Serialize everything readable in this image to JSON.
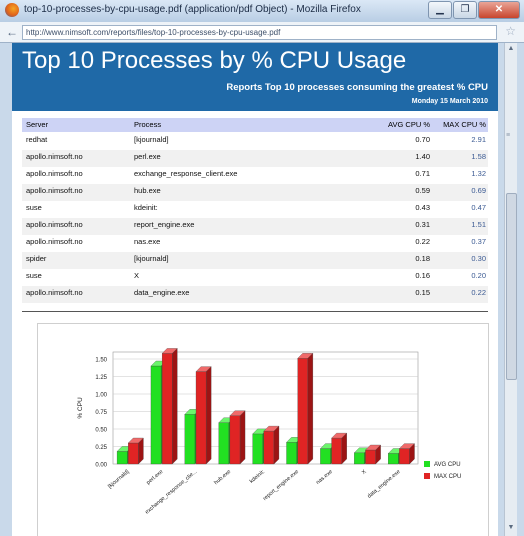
{
  "window": {
    "title": "top-10-processes-by-cpu-usage.pdf (application/pdf Object) - Mozilla Firefox",
    "url": "http://www.nimsoft.com/reports/files/top-10-processes-by-cpu-usage.pdf",
    "buttons": {
      "minimize": "▁",
      "maximize": "❐",
      "close": "✕"
    }
  },
  "report": {
    "title": "Top 10 Processes by % CPU Usage",
    "subtitle": "Reports Top 10 processes consuming the greatest % CPU",
    "date": "Monday 15 March 2010",
    "columns": [
      "Server",
      "Process",
      "AVG CPU %",
      "MAX CPU %"
    ],
    "rows": [
      {
        "server": "redhat",
        "process": "[kjournald]",
        "avg": "0.70",
        "max": "2.91"
      },
      {
        "server": "apollo.nimsoft.no",
        "process": "perl.exe",
        "avg": "1.40",
        "max": "1.58"
      },
      {
        "server": "apollo.nimsoft.no",
        "process": "exchange_response_client.exe",
        "avg": "0.71",
        "max": "1.32"
      },
      {
        "server": "apollo.nimsoft.no",
        "process": "hub.exe",
        "avg": "0.59",
        "max": "0.69"
      },
      {
        "server": "suse",
        "process": "kdeinit:",
        "avg": "0.43",
        "max": "0.47"
      },
      {
        "server": "apollo.nimsoft.no",
        "process": "report_engine.exe",
        "avg": "0.31",
        "max": "1.51"
      },
      {
        "server": "apollo.nimsoft.no",
        "process": "nas.exe",
        "avg": "0.22",
        "max": "0.37"
      },
      {
        "server": "spider",
        "process": "[kjournald]",
        "avg": "0.18",
        "max": "0.30"
      },
      {
        "server": "suse",
        "process": "X",
        "avg": "0.16",
        "max": "0.20"
      },
      {
        "server": "apollo.nimsoft.no",
        "process": "data_engine.exe",
        "avg": "0.15",
        "max": "0.22"
      }
    ]
  },
  "chart_data": {
    "type": "bar",
    "categories": [
      "[kjournald]",
      "perl.exe",
      "exchange_response_clie...",
      "hub.exe",
      "kdeinit:",
      "report_engine.exe",
      "nas.exe",
      "X",
      "data_engine.exe"
    ],
    "series": [
      {
        "name": "AVG CPU",
        "color": "#22e022",
        "values": [
          0.18,
          1.4,
          0.71,
          0.59,
          0.43,
          0.31,
          0.22,
          0.16,
          0.15
        ]
      },
      {
        "name": "MAX CPU",
        "color": "#e02424",
        "values": [
          0.3,
          1.58,
          1.32,
          0.69,
          0.47,
          1.51,
          0.37,
          0.2,
          0.22
        ]
      }
    ],
    "yticks": [
      "0.00",
      "0.25",
      "0.50",
      "0.75",
      "1.00",
      "1.25",
      "1.50"
    ],
    "ylabel": "% CPU",
    "ylim": [
      0,
      1.6
    ],
    "legend_position": "right",
    "grid": true
  },
  "icons": {
    "back": "back-arrow-icon",
    "bookmark": "star-icon",
    "browser": "firefox-icon"
  }
}
